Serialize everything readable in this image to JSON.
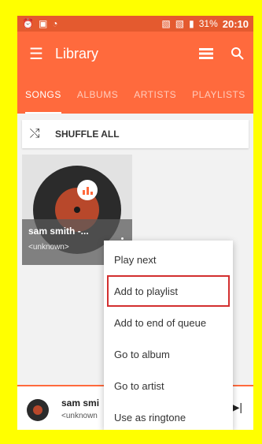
{
  "statusbar": {
    "battery": "31%",
    "time": "20:10"
  },
  "appbar": {
    "title": "Library"
  },
  "tabs": [
    {
      "label": "SONGS"
    },
    {
      "label": "ALBUMS"
    },
    {
      "label": "ARTISTS"
    },
    {
      "label": "PLAYLISTS"
    }
  ],
  "shuffle": {
    "label": "SHUFFLE ALL"
  },
  "song_card": {
    "title": "sam smith -...",
    "artist": "<unknown>"
  },
  "menu": {
    "items": [
      {
        "label": "Play next"
      },
      {
        "label": "Add to playlist"
      },
      {
        "label": "Add to end of queue"
      },
      {
        "label": "Go to album"
      },
      {
        "label": "Go to artist"
      },
      {
        "label": "Use as ringtone"
      }
    ]
  },
  "now_playing": {
    "title": "sam smi",
    "artist": "<unknown"
  },
  "colors": {
    "accent": "#ff6a3d",
    "statusbar": "#e45a2f",
    "highlight": "#d32f2f",
    "frame": "#ffff00"
  }
}
